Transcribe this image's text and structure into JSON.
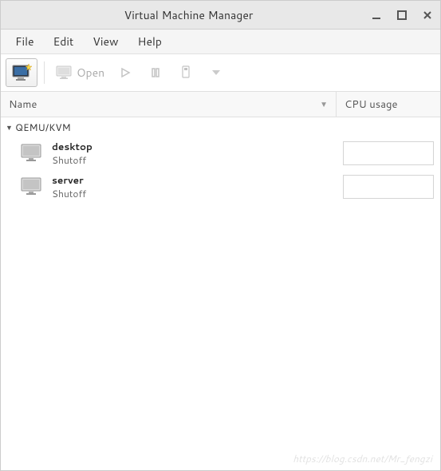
{
  "window": {
    "title": "Virtual Machine Manager"
  },
  "menu": {
    "file": "File",
    "edit": "Edit",
    "view": "View",
    "help": "Help"
  },
  "toolbar": {
    "open_label": "Open"
  },
  "columns": {
    "name": "Name",
    "cpu": "CPU usage"
  },
  "connection": {
    "name": "QEMU/KVM"
  },
  "vms": [
    {
      "name": "desktop",
      "status": "Shutoff"
    },
    {
      "name": "server",
      "status": "Shutoff"
    }
  ],
  "watermark": "https://blog.csdn.net/Mr_fengzi"
}
